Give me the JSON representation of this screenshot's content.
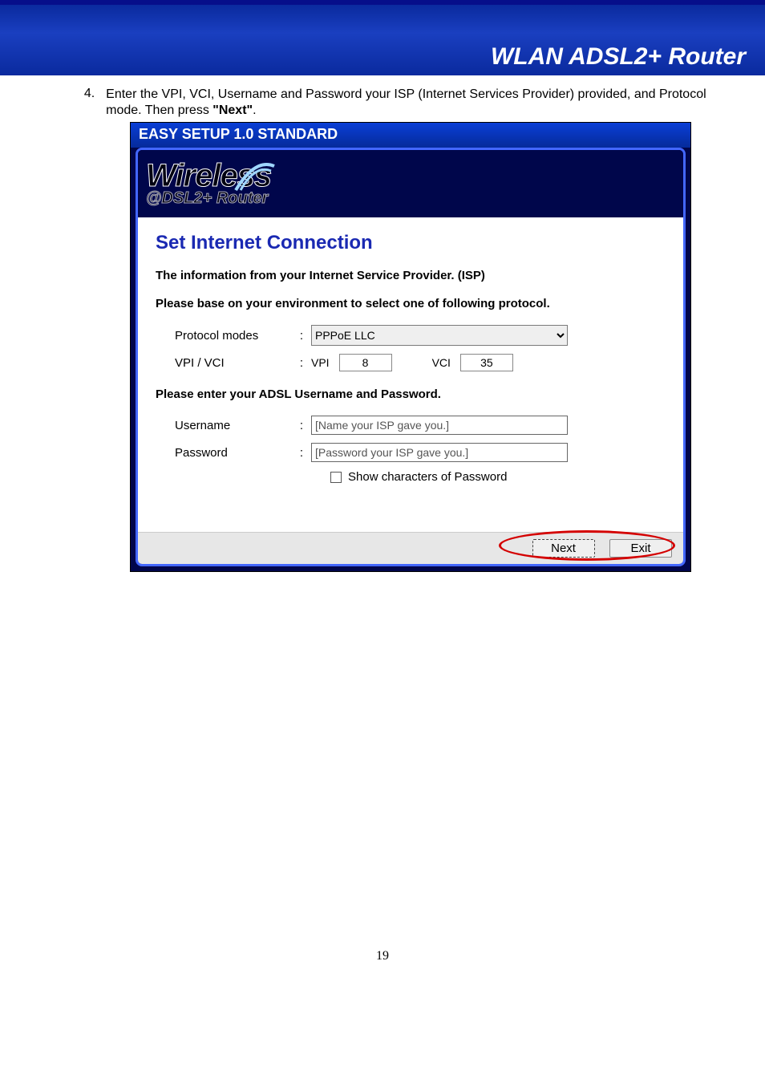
{
  "header": {
    "title": "WLAN ADSL2+ Router"
  },
  "instruction": {
    "number": "4.",
    "text_a": "Enter the VPI, VCI, Username and Password your ISP (Internet Services Provider) provided, and Protocol mode. Then press ",
    "bold": "\"Next\"",
    "text_b": "."
  },
  "app": {
    "titlebar": "EASY SETUP 1.0 STANDARD",
    "logo_top": "Wireless",
    "logo_bottom": "@DSL2+ Router",
    "section_title": "Set Internet Connection",
    "info_line": "The information from your Internet Service Provider. (ISP)",
    "protocol_line": "Please base on your environment to select one of following protocol.",
    "labels": {
      "protocol": "Protocol modes",
      "vpivci": "VPI / VCI",
      "vpi": "VPI",
      "vci": "VCI",
      "username": "Username",
      "password": "Password"
    },
    "protocol_value": "PPPoE LLC",
    "vpi_value": "8",
    "vci_value": "35",
    "cred_line": "Please enter your ADSL Username and Password.",
    "username_placeholder": "[Name your ISP gave you.]",
    "password_placeholder": "[Password your ISP gave you.]",
    "show_pw": "Show characters of Password",
    "buttons": {
      "next": "Next",
      "exit": "Exit"
    }
  },
  "page_number": "19"
}
